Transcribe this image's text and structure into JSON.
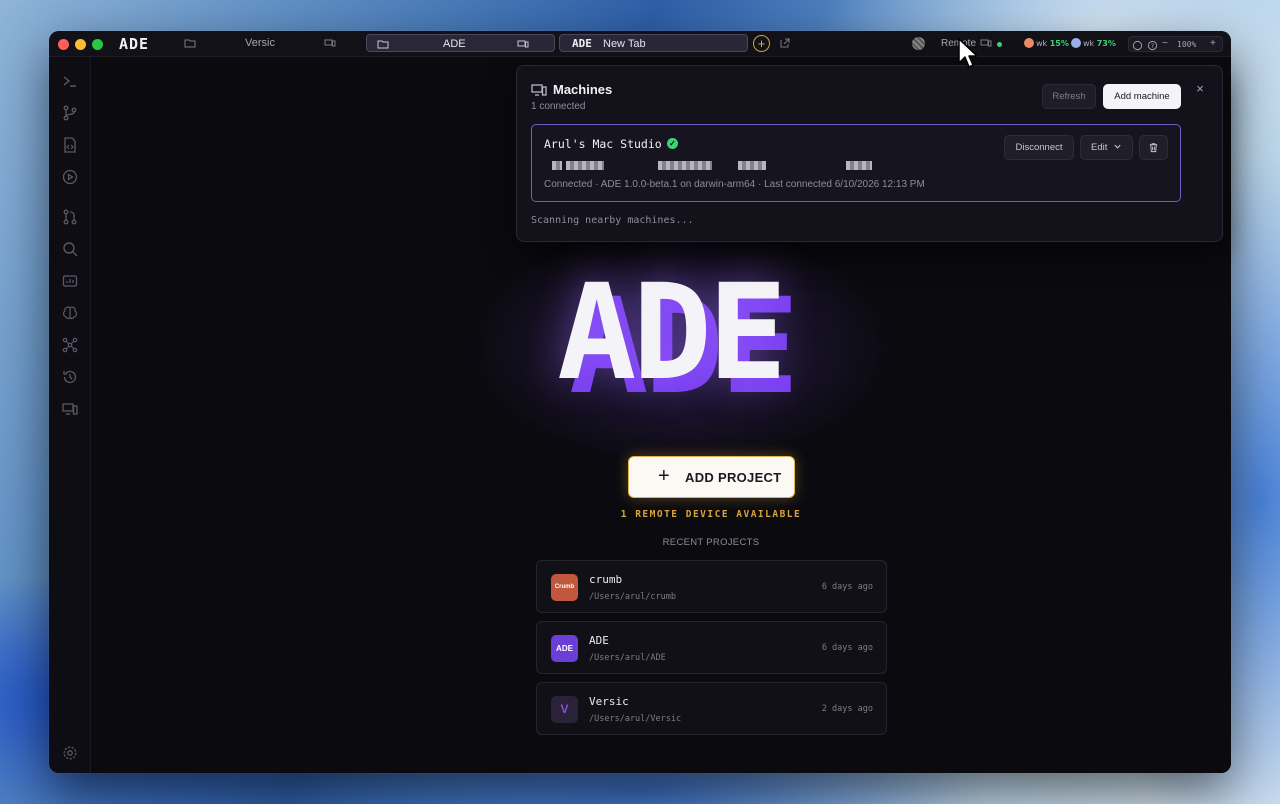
{
  "window": {
    "brand": "ADE",
    "tabs": [
      {
        "label": "Versic"
      },
      {
        "label": "ADE"
      },
      {
        "logo": "ADE",
        "label": "New Tab"
      }
    ],
    "new_tab_symbol": "+",
    "remote_label": "Remote",
    "usage": [
      {
        "prefix": "wk",
        "percent": "15%",
        "color": "#e98a6a"
      },
      {
        "prefix": "wk",
        "percent": "73%",
        "color": "#9ab0e6"
      }
    ],
    "zoom": {
      "minus": "−",
      "value": "100%",
      "plus": "+"
    }
  },
  "sidebar": {
    "icons": [
      "terminal-icon",
      "git-branch-icon",
      "file-code-icon",
      "play-circle-icon",
      "pull-request-icon",
      "search-icon",
      "dashboard-icon",
      "brain-icon",
      "workflow-icon",
      "history-icon",
      "devices-icon",
      "settings-icon"
    ]
  },
  "hero": {
    "text": "ADE"
  },
  "main": {
    "add_project": {
      "symbol": "+",
      "label": "ADD PROJECT"
    },
    "remote_available": "1 REMOTE DEVICE AVAILABLE",
    "recent_title": "RECENT PROJECTS",
    "projects": [
      {
        "name": "crumb",
        "path": "/Users/arul/crumb",
        "time": "6 days ago",
        "icon_text": "Crumb",
        "icon_color": "#c1573c"
      },
      {
        "name": "ADE",
        "path": "/Users/arul/ADE",
        "time": "6 days ago",
        "icon_text": "ADE",
        "icon_color": "#6a3fd6"
      },
      {
        "name": "Versic",
        "path": "/Users/arul/Versic",
        "time": "2 days ago",
        "icon_text": "V",
        "icon_color": "#2a2236"
      }
    ]
  },
  "machines": {
    "title": "Machines",
    "subtitle": "1 connected",
    "refresh_label": "Refresh",
    "add_label": "Add machine",
    "close_symbol": "×",
    "machine": {
      "name": "Arul's Mac Studio",
      "status": "Connected · ADE 1.0.0-beta.1 on darwin-arm64 · Last connected 6/10/2026 12:13 PM",
      "disconnect_label": "Disconnect",
      "edit_label": "Edit"
    },
    "scanning": "Scanning nearby machines..."
  }
}
